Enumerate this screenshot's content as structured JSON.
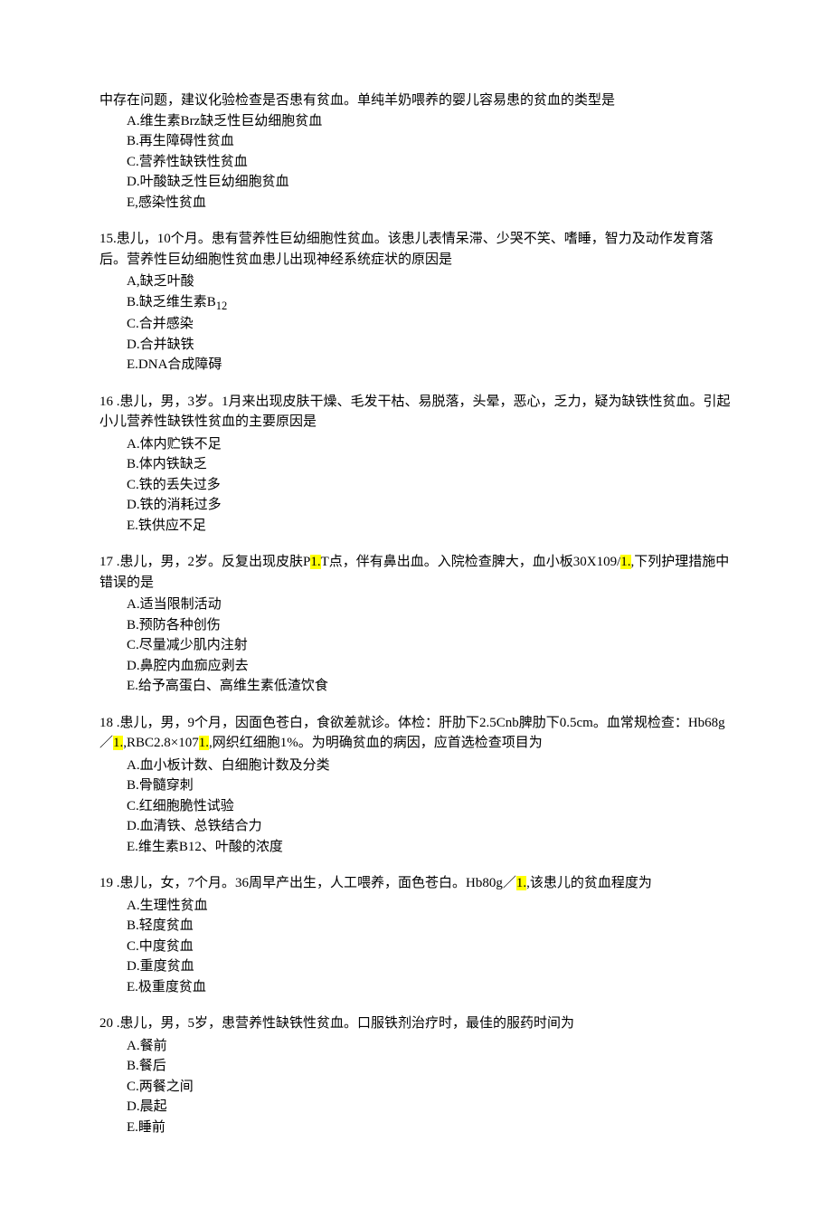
{
  "q14_cont": {
    "stem_a": "中存在问题，建议化验检查是否患有贫血。单纯羊奶喂养的婴儿容易患的贫血的类型是",
    "opts": {
      "a": "A.维生素Brz缺乏性巨幼细胞贫血",
      "b": "B.再生障碍性贫血",
      "c": "C.营养性缺铁性贫血",
      "d": "D.叶酸缺乏性巨幼细胞贫血",
      "e": "E,感染性贫血"
    }
  },
  "q15": {
    "stem": "15.患儿，10个月。患有营养性巨幼细胞性贫血。该患儿表情呆滞、少哭不笑、嗜睡，智力及动作发育落后。营养性巨幼细胞性贫血患儿出现神经系统症状的原因是",
    "opts": {
      "a": "A,缺乏叶酸",
      "b_pre": "B.缺乏维生素B",
      "b_sub": "12",
      "c": "C.合并感染",
      "d": "D.合并缺铁",
      "e": "E.DNA合成障碍"
    }
  },
  "q16": {
    "stem": "16 .患儿，男，3岁。1月来出现皮肤干燥、毛发干枯、易脱落，头晕，恶心，乏力，疑为缺铁性贫血。引起小儿营养性缺铁性贫血的主要原因是",
    "opts": {
      "a": "A.体内贮铁不足",
      "b": "B.体内铁缺乏",
      "c": "C.铁的丢失过多",
      "d": "D.铁的消耗过多",
      "e": "E.铁供应不足"
    }
  },
  "q17": {
    "stem_a": "17 .患儿，男，2岁。反复出现皮肤P",
    "stem_hl1": "1.",
    "stem_b": "T点，伴有鼻出血。入院检查脾大，血小板30X109/",
    "stem_hl2": "1.",
    "stem_c": ",下列护理措施中错误的是",
    "opts": {
      "a": "A.适当限制活动",
      "b": "B.预防各种创伤",
      "c": "C.尽量减少肌内注射",
      "d": "D.鼻腔内血痂应剥去",
      "e": "E.给予高蛋白、高维生素低渣饮食"
    }
  },
  "q18": {
    "stem_a": "18 .患儿，男，9个月，因面色苍白，食欲差就诊。体检：肝肋下2.5Cnb脾肋下0.5cm。血常规检查：Hb68g／",
    "stem_hl1": "1.",
    "stem_b": ",RBC2.8×107",
    "stem_hl2": "1.",
    "stem_c": ",网织红细胞1%。为明确贫血的病因，应首选检查项目为",
    "opts": {
      "a": "A.血小板计数、白细胞计数及分类",
      "b": "B.骨髓穿刺",
      "c": "C.红细胞脆性试验",
      "d": "D.血清铁、总铁结合力",
      "e": "E.维生素B12、叶酸的浓度"
    }
  },
  "q19": {
    "stem_a": "19 .患儿，女，7个月。36周早产出生，人工喂养，面色苍白。Hb80g／",
    "stem_hl1": "1.",
    "stem_b": ",该患儿的贫血程度为",
    "opts": {
      "a": "A.生理性贫血",
      "b": "B.轻度贫血",
      "c": "C.中度贫血",
      "d": "D.重度贫血",
      "e": "E.极重度贫血"
    }
  },
  "q20": {
    "stem": "20 .患儿，男，5岁，患营养性缺铁性贫血。口服铁剂治疗时，最佳的服药时间为",
    "opts": {
      "a": "A.餐前",
      "b": "B.餐后",
      "c": "C.两餐之间",
      "d": "D.晨起",
      "e": "E.睡前"
    }
  }
}
